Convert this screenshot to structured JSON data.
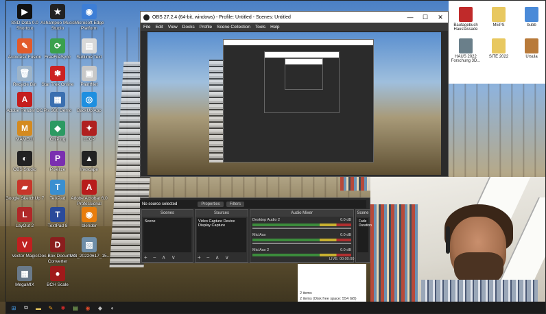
{
  "desktop_icons_left": [
    {
      "label": "SSD Data 0.0 Shortcut",
      "color": "#111",
      "glyph": "▶"
    },
    {
      "label": "Ashampoo Music Studio",
      "color": "#222",
      "glyph": "★"
    },
    {
      "label": "Microsoft Edge Platform",
      "color": "#3d7ed6",
      "glyph": "◉"
    },
    {
      "label": "Autodesk Fusion",
      "color": "#e25a2b",
      "glyph": "✎"
    },
    {
      "label": "FreeFileSync",
      "color": "#3aa04d",
      "glyph": "⟳"
    },
    {
      "label": "Sublime Text",
      "color": "#d8d8d8",
      "glyph": "▤"
    },
    {
      "label": "Recycle Bin",
      "color": "#9db4c9",
      "glyph": "🗑"
    },
    {
      "label": "Star Trek Online",
      "color": "#cc2222",
      "glyph": "✱"
    },
    {
      "label": "PaintNet",
      "color": "#c8c8c8",
      "glyph": "▣"
    },
    {
      "label": "Adobe Reader DC",
      "color": "#c41d1d",
      "glyph": "A"
    },
    {
      "label": "Pix 360 Demo",
      "color": "#3a6fb0",
      "glyph": "▦"
    },
    {
      "label": "BackUp App",
      "color": "#1e8fe0",
      "glyph": "◎"
    },
    {
      "label": "MAMEUI",
      "color": "#d48a20",
      "glyph": "M"
    },
    {
      "label": "ChiPing",
      "color": "#2c9a62",
      "glyph": "◆"
    },
    {
      "label": "LCCP",
      "color": "#b02020",
      "glyph": "✦"
    },
    {
      "label": "OBS Studio",
      "color": "#222",
      "glyph": "◐"
    },
    {
      "label": "Pixelize",
      "color": "#7a2fb0",
      "glyph": "P"
    },
    {
      "label": "Inkscape",
      "color": "#222",
      "glyph": "▲"
    },
    {
      "label": "Google SketchUp 7",
      "color": "#c7362a",
      "glyph": "▰"
    },
    {
      "label": "TeXPad",
      "color": "#3a8fd0",
      "glyph": "T"
    },
    {
      "label": "Adobe Acrobat 6.0 Professional",
      "color": "#b81c1c",
      "glyph": "A"
    },
    {
      "label": "LayOut 2",
      "color": "#b02828",
      "glyph": "L"
    },
    {
      "label": "TextPad 8",
      "color": "#2a4a9a",
      "glyph": "T"
    },
    {
      "label": "blender",
      "color": "#e87d0d",
      "glyph": "◉"
    },
    {
      "label": "Vector Magic",
      "color": "#c02020",
      "glyph": "V"
    },
    {
      "label": "Doc-Box Document Converter",
      "color": "#8a1e1e",
      "glyph": "D"
    },
    {
      "label": "IMG_20220617_15...",
      "color": "#6f8ea8",
      "glyph": "▨"
    },
    {
      "label": "MegaMIX",
      "color": "#6a7a8a",
      "glyph": "▦"
    },
    {
      "label": "BCH Scale",
      "color": "#a01a1a",
      "glyph": "●"
    }
  ],
  "desktop_icons_right": [
    {
      "label": "Bautagebuch Hausfassade",
      "color": "#c02a2a"
    },
    {
      "label": "MEPS",
      "color": "#e8c860"
    },
    {
      "label": "bubb",
      "color": "#4a8ad8"
    },
    {
      "label": "HAUS 2022 Forschung 3D...",
      "color": "#6a7f8a"
    },
    {
      "label": "SITE 2022",
      "color": "#e8c860"
    },
    {
      "label": "Ursula",
      "color": "#b87a3a"
    }
  ],
  "obs": {
    "title": "OBS 27.2.4 (64-bit, windows) - Profile: Untitled - Scenes: Untitled",
    "menu": [
      "File",
      "Edit",
      "View",
      "Docks",
      "Profile",
      "Scene Collection",
      "Tools",
      "Help"
    ],
    "window_controls": [
      "—",
      "☐",
      "✕"
    ],
    "no_source": "No source selected",
    "properties_btn": "Properties",
    "filters_btn": "Filters",
    "scenes_header": "Scenes",
    "scenes_item": "Scene",
    "sources_header": "Sources",
    "sources_items": [
      "Video Capture Device",
      "Display Capture"
    ],
    "mixer_header": "Audio Mixer",
    "mixer_channels": [
      {
        "name": "Desktop Audio 2",
        "db": "0.0 dB"
      },
      {
        "name": "Mic/Aux",
        "db": "0.0 dB"
      },
      {
        "name": "Mic/Aux 2",
        "db": "0.0 dB"
      }
    ],
    "transitions_header": "Scene",
    "transitions_items": [
      "Fade",
      "Duration"
    ],
    "live_time": "LIVE: 00:00:00",
    "dock_footer": "+ − ∧ ∨"
  },
  "explorer": {
    "items_count": "2 items",
    "status": "2 items (Disk free space: 554 GB)"
  },
  "taskbar_icons": [
    {
      "name": "windows-start-icon",
      "glyph": "⊞",
      "color": "#4aa3f0"
    },
    {
      "name": "task-view-icon",
      "glyph": "⧉",
      "color": "#ddd"
    },
    {
      "name": "file-explorer-icon",
      "glyph": "▬",
      "color": "#e8c860"
    },
    {
      "name": "pencil-icon",
      "glyph": "✎",
      "color": "#f0a020"
    },
    {
      "name": "app-red-icon",
      "glyph": "✱",
      "color": "#d02a2a"
    },
    {
      "name": "notepad-icon",
      "glyph": "▤",
      "color": "#9ad06a"
    },
    {
      "name": "chrome-icon",
      "glyph": "◉",
      "color": "#e04a2a"
    },
    {
      "name": "app-dark-icon",
      "glyph": "◆",
      "color": "#c0c0c0"
    },
    {
      "name": "obs-taskbar-icon",
      "glyph": "◐",
      "color": "#ddd"
    }
  ]
}
